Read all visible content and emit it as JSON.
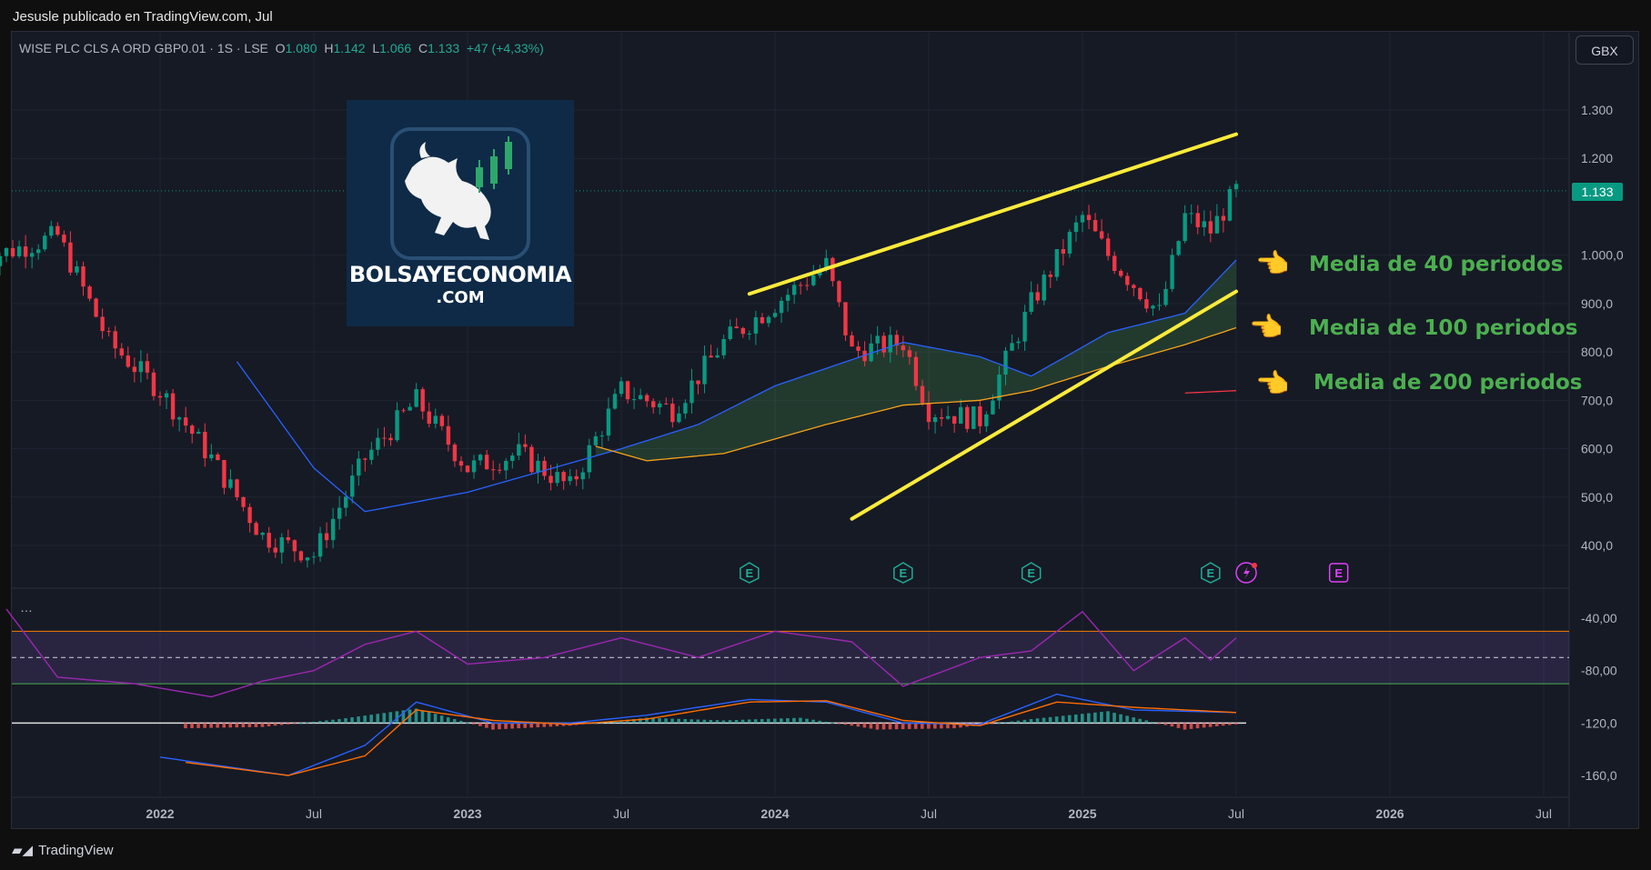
{
  "header": {
    "publisher": "Jesusle publicado en TradingView.com, Jul"
  },
  "symbol": {
    "name": "WISE PLC CLS A ORD GBP0.01 · 1S · LSE",
    "open_label": "O",
    "open": "1.080",
    "high_label": "H",
    "high": "1.142",
    "low_label": "L",
    "low": "1.066",
    "close_label": "C",
    "close": "1.133",
    "change": "+47 (+4,33%)"
  },
  "currency_button": "GBX",
  "last_price_tag": "1.133",
  "logo": {
    "brand": "BOLSAYECONOMIA",
    "sub": ".COM"
  },
  "annotations": [
    {
      "text": "Media de 40 periodos",
      "icon": "pointing-hand-icon"
    },
    {
      "text": "Media de 100 periodos",
      "icon": "pointing-hand-icon"
    },
    {
      "text": "Media de 200 periodos",
      "icon": "pointing-hand-icon"
    }
  ],
  "pane_menu": "…",
  "earnings_marker": "E",
  "footer": {
    "brand": "TradingView"
  },
  "colors": {
    "background": "#161a25",
    "up": "#089981",
    "down": "#f23645",
    "ma40": "#2962ff",
    "ma100": "#f7a21b",
    "ma200": "#f23645",
    "trendline": "#ffeb3b",
    "rsi": "#9c27b0",
    "annotation": "#4caf50"
  },
  "chart_data": [
    {
      "type": "candlestick",
      "title": "WISE PLC CLS A ORD GBP0.01 · 1S · LSE",
      "price_axis": {
        "ticks": [
          "1.300",
          "1.200",
          "1.000,0",
          "900,0",
          "800,0",
          "700,0",
          "600,0",
          "500,0",
          "400,0"
        ],
        "range": [
          330,
          1340
        ]
      },
      "time_axis": {
        "ticks": [
          "2022",
          "Jul",
          "2023",
          "Jul",
          "2024",
          "Jul",
          "2025",
          "Jul",
          "2026",
          "Jul"
        ]
      },
      "close_path": {
        "x": [
          "2021-06",
          "2021-09",
          "2021-11",
          "2022-01",
          "2022-03",
          "2022-05",
          "2022-07",
          "2022-09",
          "2022-11",
          "2023-01",
          "2023-03",
          "2023-05",
          "2023-07",
          "2023-09",
          "2023-11",
          "2024-01",
          "2024-03",
          "2024-04",
          "2024-06",
          "2024-07",
          "2024-09",
          "2024-11",
          "2025-01",
          "2025-02",
          "2025-04",
          "2025-05",
          "2025-06",
          "2025-07"
        ],
        "close": [
          990,
          1040,
          820,
          720,
          580,
          420,
          380,
          580,
          700,
          560,
          590,
          520,
          720,
          680,
          820,
          900,
          980,
          800,
          820,
          680,
          660,
          900,
          1080,
          1000,
          880,
          1080,
          1050,
          1133
        ]
      },
      "series": [
        {
          "name": "Media de 40 periodos",
          "x": [
            "2022-04",
            "2022-07",
            "2022-09",
            "2023-01",
            "2023-07",
            "2023-10",
            "2024-01",
            "2024-06",
            "2024-09",
            "2024-11",
            "2025-02",
            "2025-05",
            "2025-07"
          ],
          "values": [
            780,
            560,
            470,
            510,
            600,
            650,
            730,
            820,
            790,
            750,
            840,
            880,
            990
          ]
        },
        {
          "name": "Media de 100 periodos",
          "x": [
            "2023-06",
            "2023-08",
            "2023-11",
            "2024-03",
            "2024-06",
            "2024-09",
            "2024-11",
            "2025-02",
            "2025-05",
            "2025-07"
          ],
          "values": [
            605,
            575,
            590,
            650,
            690,
            700,
            720,
            770,
            815,
            850
          ]
        },
        {
          "name": "Media de 200 periodos",
          "x": [
            "2025-05",
            "2025-07"
          ],
          "values": [
            715,
            720
          ]
        }
      ],
      "trendlines": [
        {
          "x": [
            "2023-12",
            "2025-07"
          ],
          "values": [
            920,
            1250
          ]
        },
        {
          "x": [
            "2024-04",
            "2025-07"
          ],
          "values": [
            455,
            925
          ]
        }
      ],
      "earnings": [
        "2023-12",
        "2024-06",
        "2024-11",
        "2025-06",
        "2025-11"
      ]
    },
    {
      "type": "line",
      "title": "",
      "yaxis": {
        "ticks": [
          "-40,00",
          "-80,00",
          "-120,0",
          "-160,0"
        ],
        "range": [
          -170,
          -30
        ]
      },
      "bands": [
        -50,
        -70,
        -90
      ],
      "series": [
        {
          "name": "",
          "x": [
            "2021-07",
            "2021-09",
            "2021-12",
            "2022-03",
            "2022-05",
            "2022-07",
            "2022-09",
            "2022-11",
            "2023-01",
            "2023-04",
            "2023-07",
            "2023-10",
            "2024-01",
            "2024-04",
            "2024-06",
            "2024-09",
            "2024-11",
            "2025-01",
            "2025-03",
            "2025-05",
            "2025-06",
            "2025-07"
          ],
          "values": [
            -33,
            -85,
            -90,
            -100,
            -88,
            -80,
            -60,
            -50,
            -75,
            -70,
            -55,
            -70,
            -50,
            -58,
            -92,
            -70,
            -65,
            -35,
            -80,
            -55,
            -72,
            -55
          ]
        },
        {
          "name": "",
          "x": [
            "2022-01",
            "2022-06",
            "2022-09",
            "2022-11",
            "2023-02",
            "2023-05",
            "2023-08",
            "2023-12",
            "2024-03",
            "2024-06",
            "2024-09",
            "2024-12",
            "2025-03",
            "2025-05",
            "2025-07"
          ],
          "values": [
            -146,
            -160,
            -137,
            -104,
            -120,
            -120,
            -114,
            -102,
            -104,
            -120,
            -121,
            -98,
            -110,
            -111,
            -112
          ]
        },
        {
          "name": "",
          "x": [
            "2022-02",
            "2022-06",
            "2022-09",
            "2022-11",
            "2023-02",
            "2023-05",
            "2023-08",
            "2023-12",
            "2024-03",
            "2024-06",
            "2024-09",
            "2024-12",
            "2025-03",
            "2025-05",
            "2025-07"
          ],
          "values": [
            -150,
            -160,
            -145,
            -110,
            -118,
            -121,
            -117,
            -104,
            -103,
            -118,
            -122,
            -104,
            -108,
            -110,
            -112
          ]
        }
      ],
      "histogram": {
        "x": [
          "2022-02",
          "2022-05",
          "2022-08",
          "2022-11",
          "2023-02",
          "2023-05",
          "2023-08",
          "2023-11",
          "2024-02",
          "2024-05",
          "2024-08",
          "2024-11",
          "2025-02",
          "2025-05",
          "2025-07"
        ],
        "values": [
          -4,
          -3,
          3,
          11,
          -5,
          -2,
          4,
          2,
          4,
          -5,
          -4,
          3,
          9,
          -5,
          -1
        ]
      }
    }
  ]
}
